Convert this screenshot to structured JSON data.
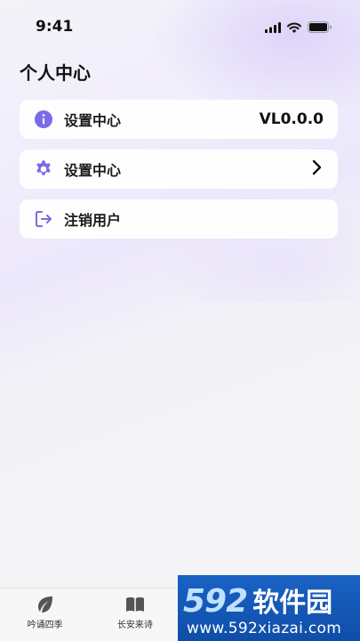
{
  "status_bar": {
    "time": "9:41"
  },
  "page": {
    "title": "个人中心"
  },
  "cards": [
    {
      "label": "设置中心",
      "value": "VL0.0.0",
      "icon": "info-icon"
    },
    {
      "label": "设置中心",
      "icon": "gear-icon",
      "trailing": "chevron-right-icon"
    },
    {
      "label": "注销用户",
      "icon": "logout-icon"
    }
  ],
  "tabs": [
    {
      "label": "吟诵四季",
      "icon": "leaf-icon"
    },
    {
      "label": "长安来诗",
      "icon": "book-icon"
    },
    {
      "label": "",
      "icon": ""
    },
    {
      "label": "",
      "icon": ""
    }
  ],
  "watermark": {
    "number": "592",
    "brand": "软件园",
    "url": "www.592xiazai.com"
  },
  "colors": {
    "accent": "#7b6be6",
    "watermark_bg": "#1a62c4"
  }
}
